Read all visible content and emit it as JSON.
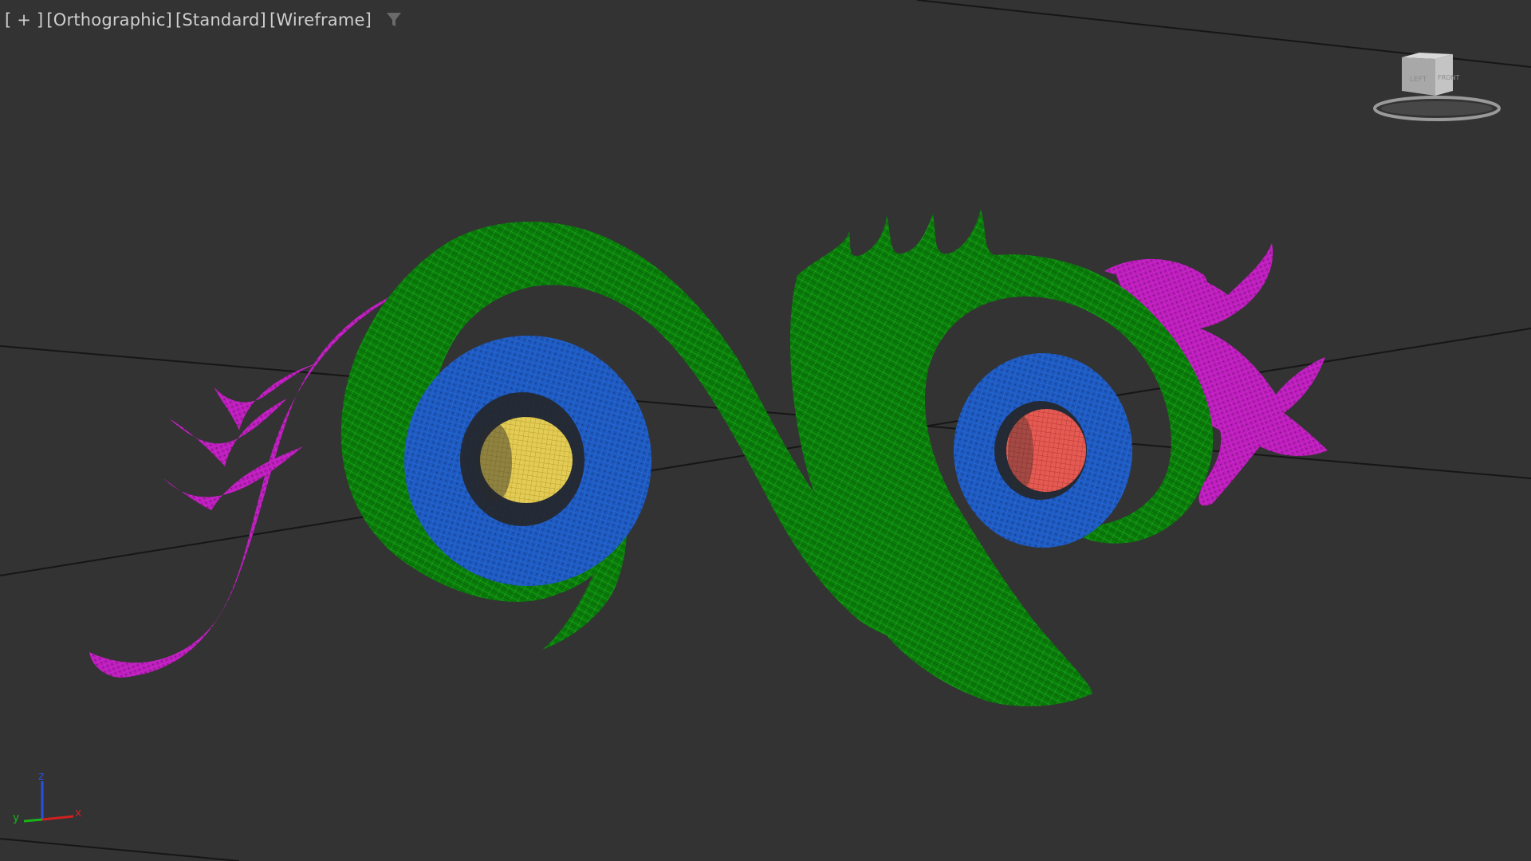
{
  "viewport": {
    "menus": [
      {
        "label": "+"
      },
      {
        "label": "Orthographic"
      },
      {
        "label": "Standard"
      },
      {
        "label": "Wireframe"
      }
    ],
    "filter_icon": "funnel-icon",
    "viewcube": {
      "faces": [
        "LEFT",
        "FRONT"
      ]
    },
    "axis": {
      "x": "x",
      "y": "y",
      "z": "z"
    }
  },
  "colors": {
    "background": "#333333",
    "grid_line": "#151515",
    "green_wire": "#0e8c0e",
    "magenta_wire": "#c21ec2",
    "blue_wire": "#1e5dc4",
    "yellow_wire": "#e8d15a",
    "red_wire": "#e85a52",
    "axis_x": "#d02020",
    "axis_y": "#18b418",
    "axis_z": "#2850e0"
  }
}
